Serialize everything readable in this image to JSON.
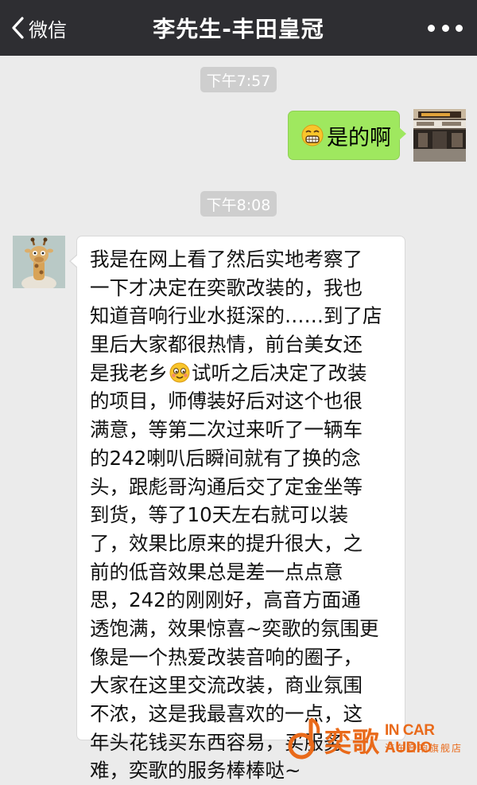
{
  "nav": {
    "back_label": "微信",
    "title": "李先生-丰田皇冠",
    "back_icon": "chevron-left-icon",
    "more_icon": "more-dots-icon"
  },
  "colors": {
    "nav_bg": "#2e2e32",
    "chat_bg": "#ebebeb",
    "sent_bubble": "#9fe85f",
    "received_bubble": "#ffffff",
    "brand_orange": "#e96a1a"
  },
  "messages": [
    {
      "type": "timestamp",
      "text": "下午7:57"
    },
    {
      "type": "sent",
      "emoji": "grinning-face-emoji",
      "text": "是的啊",
      "avatar": "store-photo-avatar"
    },
    {
      "type": "timestamp",
      "text": "下午8:08"
    },
    {
      "type": "received",
      "avatar": "giraffe-avatar",
      "lines": [
        "我是在网上看了然后实地考察了",
        "一下才决定在奕歌改装的，我也",
        "知道音响行业水挺深的……到了店",
        "里后大家都很热情，前台美女还",
        {
          "before": "是我老乡",
          "emoji": "blushing-face-emoji",
          "after": "试听之后决定了改装"
        },
        "的项目，师傅装好后对这个也很",
        "满意，等第二次过来听了一辆车",
        "的242喇叭后瞬间就有了换的念",
        "头，跟彪哥沟通后交了定金坐等",
        "到货，等了10天左右就可以装",
        "了，效果比原来的提升很大，之",
        "前的低音效果总是差一点点意",
        "思，242的刚刚好，高音方面通",
        "透饱满，效果惊喜~奕歌的氛围更",
        "像是一个热爱改装音响的圈子，",
        "大家在这里交流改装，商业氛围",
        "不浓，这是我最喜欢的一点，这",
        "年头花钱买东西容易，买服务",
        "难，奕歌的服务棒棒哒~"
      ]
    }
  ],
  "watermark": {
    "brand_cn": "奕歌",
    "brand_en": "IN CAR AUDIO",
    "tagline": "汽车音响旗舰店",
    "logo_icon": "music-note-logo-icon"
  }
}
